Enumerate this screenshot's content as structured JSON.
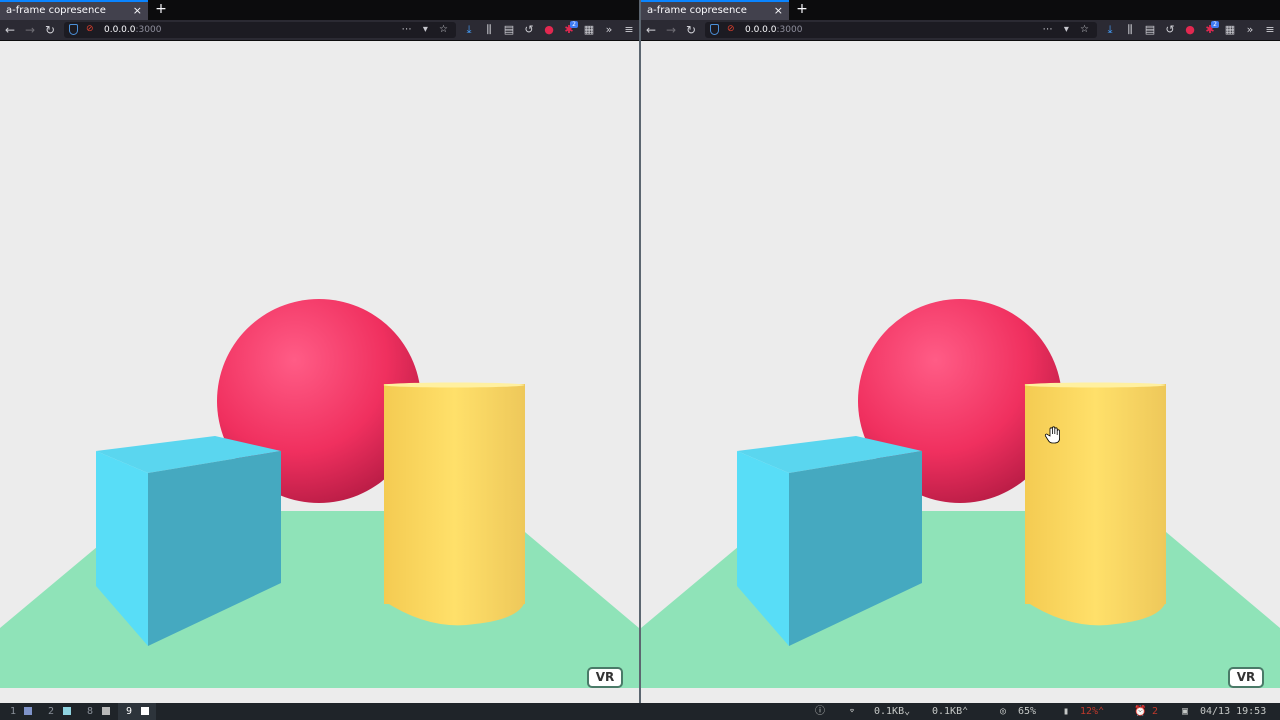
{
  "windows": [
    {
      "tab_title": "a-frame copresence",
      "tab_close": "×",
      "new_tab": "+",
      "url_host": "0.0.0.0",
      "url_port": ":3000",
      "vr_label": "VR"
    },
    {
      "tab_title": "a-frame copresence",
      "tab_close": "×",
      "new_tab": "+",
      "url_host": "0.0.0.0",
      "url_port": ":3000",
      "vr_label": "VR"
    }
  ],
  "toolbar_icons": {
    "back": "←",
    "forward": "→",
    "reload": "↻",
    "page_actions": "⋯",
    "extensions_badge": "2"
  },
  "colors": {
    "sky": "#ececec",
    "ground": "#8fe3b8",
    "sphere": "#ef2d5e",
    "box": "#4cc3d9",
    "cylinder": "#ffc65d"
  },
  "statusbar": {
    "workspaces": [
      {
        "num": "1",
        "color": "#7f93c9"
      },
      {
        "num": "2",
        "color": "#8fd3e0"
      },
      {
        "num": "8",
        "color": "#b8b8b8"
      },
      {
        "num": "9",
        "color": "#ffffff",
        "active": true
      }
    ],
    "net_down": "0.1KB",
    "net_up": "0.1KB",
    "volume": "65%",
    "battery": "12%",
    "alarms": "2",
    "datetime": "04/13 19:53"
  }
}
